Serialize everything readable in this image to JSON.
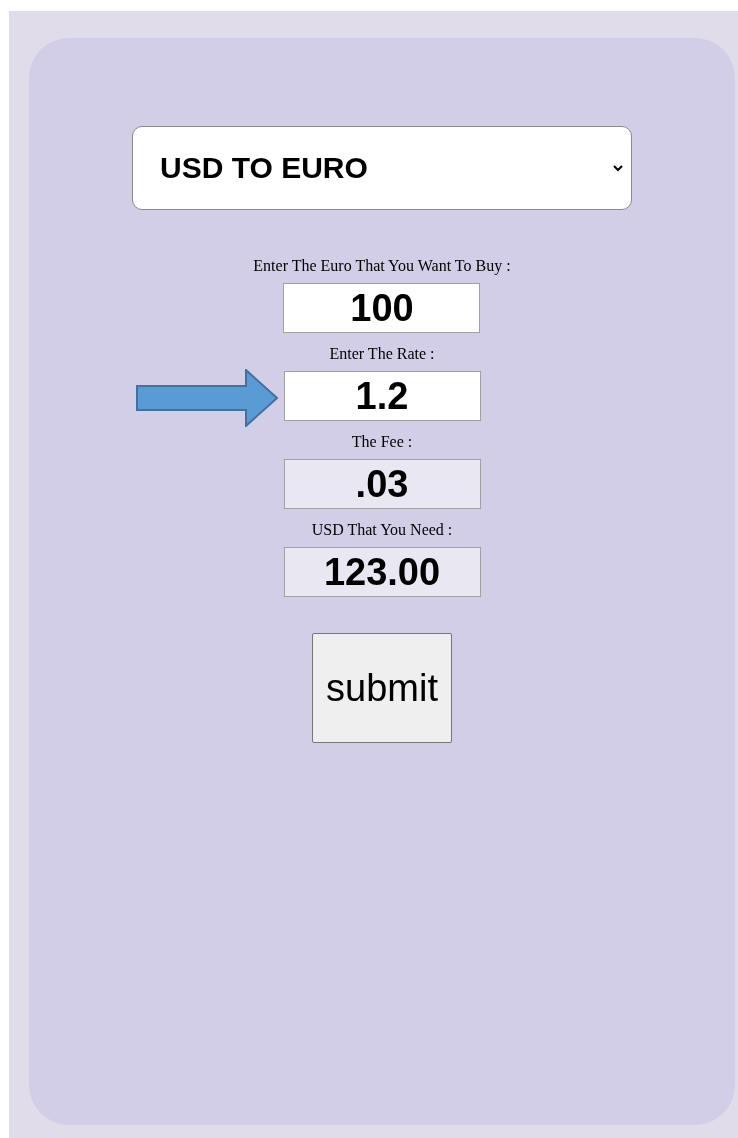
{
  "converter": {
    "value": "USD TO EURO"
  },
  "fields": [
    {
      "label": "Enter The Euro That You Want To Buy :",
      "value": "100",
      "disabled": false,
      "arrow": false
    },
    {
      "label": "Enter The Rate :",
      "value": "1.2",
      "disabled": false,
      "arrow": true
    },
    {
      "label": "The Fee :",
      "value": ".03",
      "disabled": true,
      "arrow": false
    },
    {
      "label": "USD That You Need :",
      "value": "123.00",
      "disabled": true,
      "arrow": false
    }
  ],
  "submit": {
    "label": "submit"
  }
}
